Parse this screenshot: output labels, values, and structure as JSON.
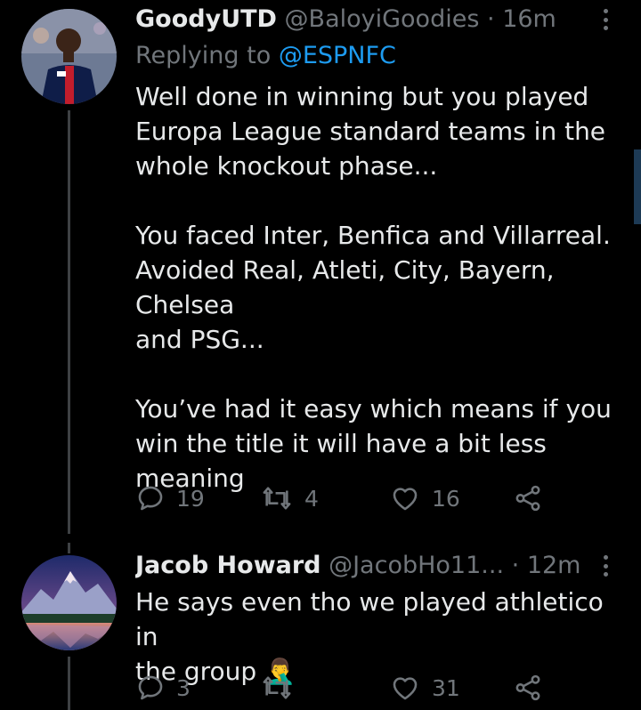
{
  "tweet1": {
    "display_name": "GoodyUTD",
    "handle": "@BaloyiGoodies",
    "separator": "·",
    "time": "16m",
    "replying_prefix": "Replying to",
    "replying_mention": "@ESPNFC",
    "text": "Well done in winning but you played\nEuropa League standard teams in the\nwhole knockout phase...\n\nYou faced Inter, Benfica and Villarreal.\nAvoided Real, Atleti, City, Bayern, Chelsea\nand PSG...\n\nYou’ve had it easy which means if you\nwin the title it will have a bit less\nmeaning",
    "reply_count": "19",
    "retweet_count": "4",
    "like_count": "16",
    "avatar_icon": "player-avatar"
  },
  "tweet2": {
    "display_name": "Jacob Howard",
    "handle": "@JacobHo11...",
    "separator": "·",
    "time": "12m",
    "text": "He says even tho we played athletico in\nthe group 🤦‍♂",
    "reply_count": "3",
    "retweet_count": "",
    "like_count": "31",
    "avatar_icon": "mountain-landscape-avatar"
  },
  "colors": {
    "background": "#000000",
    "text": "#e7e9ea",
    "muted": "#71767b",
    "link": "#1d9bf0",
    "thread_line": "#3e4144"
  }
}
